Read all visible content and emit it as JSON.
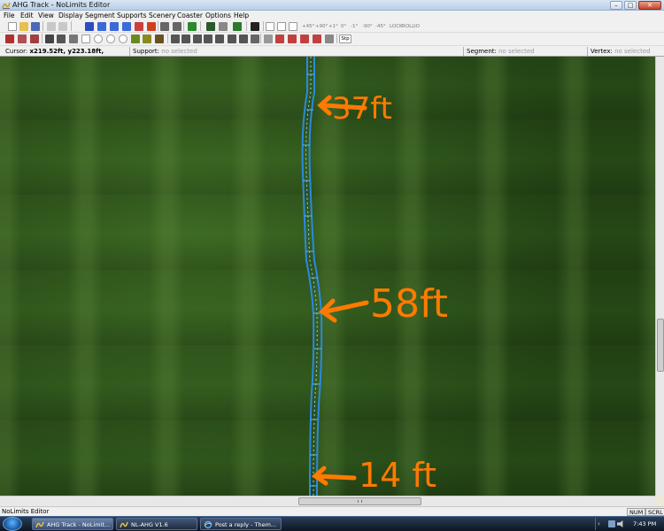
{
  "window": {
    "title": "AHG Track - NoLimits Editor",
    "min_glyph": "–",
    "max_glyph": "□",
    "close_glyph": "✕"
  },
  "menu": [
    "File",
    "Edit",
    "View",
    "Display",
    "Segment",
    "Supports",
    "Scenery",
    "Coaster",
    "Options",
    "Help"
  ],
  "toolbar": {
    "faded_labels": [
      "+45°",
      "+90°",
      "+1°",
      "0°",
      "-1°",
      "-90°",
      "-45°",
      "LOCK",
      "ROLL",
      "IO"
    ],
    "step_label": "Stp"
  },
  "status_top": {
    "cursor_label": "Cursor:",
    "cursor_value": "x219.52ft, y223.18ft,",
    "support_label": "Support:",
    "support_value": "no selected",
    "segment_label": "Segment:",
    "segment_value": "no selected",
    "vertex_label": "Vertex:",
    "vertex_value": "no selected"
  },
  "annotations": [
    {
      "text": "37ft"
    },
    {
      "text": "58ft"
    },
    {
      "text": "14 ft"
    }
  ],
  "colors": {
    "annotation": "#ff7a00",
    "track": "#3aa0ff",
    "grass": "#2f5a1c"
  },
  "status_bottom": {
    "text": "NoLimits Editor",
    "num": "NUM",
    "scrl": "SCRL"
  },
  "taskbar": {
    "tasks": [
      {
        "label": "AHG Track - NoLimit...",
        "active": true,
        "icon": "coaster-icon"
      },
      {
        "label": "NL-AHG V1.6",
        "active": false,
        "icon": "coaster-icon"
      },
      {
        "label": "Post a reply - Them...",
        "active": false,
        "icon": "internet-explorer-icon"
      }
    ],
    "clock": "7:43 PM",
    "tray_chevron": "‹"
  }
}
